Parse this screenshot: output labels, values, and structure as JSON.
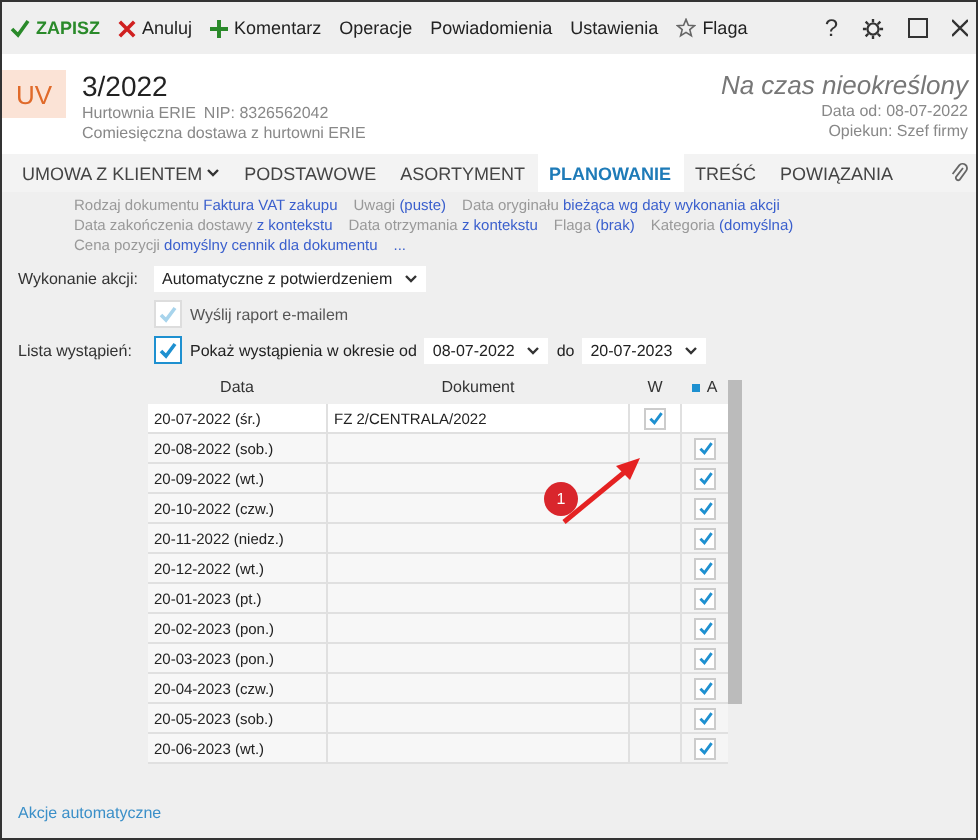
{
  "toolbar": {
    "items": [
      {
        "kind": "save",
        "label": "ZAPISZ"
      },
      {
        "kind": "cancel",
        "label": "Anuluj"
      },
      {
        "kind": "add",
        "label": "Komentarz"
      },
      {
        "kind": "plain",
        "label": "Operacje"
      },
      {
        "kind": "plain",
        "label": "Powiadomienia"
      },
      {
        "kind": "plain",
        "label": "Ustawienia"
      },
      {
        "kind": "star",
        "label": "Flaga"
      }
    ],
    "right": {
      "help": "?"
    }
  },
  "header": {
    "badge": "UV",
    "number": "3/2022",
    "company": "Hurtownia ERIE",
    "nip": "NIP: 8326562042",
    "description": "Comiesięczna dostawa z hurtowni ERIE",
    "status": "Na czas nieokreślony",
    "date": "Data od: 08-07-2022",
    "owner": "Opiekun: Szef firmy"
  },
  "tabs": [
    {
      "label": "UMOWA Z KLIENTEM",
      "selected": false,
      "dropdown": true
    },
    {
      "label": "PODSTAWOWE",
      "selected": false,
      "dropdown": false
    },
    {
      "label": "ASORTYMENT",
      "selected": false,
      "dropdown": false
    },
    {
      "label": "PLANOWANIE",
      "selected": true,
      "dropdown": false
    },
    {
      "label": "TREŚĆ",
      "selected": false,
      "dropdown": false
    },
    {
      "label": "POWIĄZANIA",
      "selected": false,
      "dropdown": false
    }
  ],
  "properties": [
    [
      {
        "label": "Rodzaj dokumentu",
        "value": "Faktura VAT zakupu"
      },
      {
        "label": "Uwagi",
        "value": "(puste)"
      },
      {
        "label": "Data oryginału",
        "value": "bieżąca wg daty wykonania akcji"
      }
    ],
    [
      {
        "label": "Data zakończenia dostawy",
        "value": "z kontekstu"
      },
      {
        "label": "Data otrzymania",
        "value": "z kontekstu"
      },
      {
        "label": "Flaga",
        "value": "(brak)"
      },
      {
        "label": "Kategoria",
        "value": "(domyślna)"
      }
    ],
    [
      {
        "label": "Cena pozycji",
        "value": "domyślny cennik dla dokumentu"
      },
      {
        "value": "..."
      }
    ]
  ],
  "execution": {
    "label": "Wykonanie akcji:",
    "value": "Automatyczne z potwierdzeniem"
  },
  "report": {
    "label": "Wyślij raport e-mailem",
    "checked": true,
    "disabled": true
  },
  "occurrences": {
    "label": "Lista wystąpień:",
    "checkbox_label": "Pokaż wystąpienia w okresie od",
    "checked": true,
    "from": "08-07-2022",
    "to_label": "do",
    "to": "20-07-2023"
  },
  "table": {
    "columns": [
      "Data",
      "Dokument",
      "W",
      "A"
    ],
    "rows": [
      {
        "date": "20-07-2022 (śr.)",
        "document": "FZ 2/CENTRALA/2022",
        "w_checked": true,
        "a_checked": false
      },
      {
        "date": "20-08-2022 (sob.)",
        "document": "",
        "w_checked": false,
        "a_checked": true
      },
      {
        "date": "20-09-2022 (wt.)",
        "document": "",
        "w_checked": false,
        "a_checked": true
      },
      {
        "date": "20-10-2022 (czw.)",
        "document": "",
        "w_checked": false,
        "a_checked": true
      },
      {
        "date": "20-11-2022 (niedz.)",
        "document": "",
        "w_checked": false,
        "a_checked": true
      },
      {
        "date": "20-12-2022 (wt.)",
        "document": "",
        "w_checked": false,
        "a_checked": true
      },
      {
        "date": "20-01-2023 (pt.)",
        "document": "",
        "w_checked": false,
        "a_checked": true
      },
      {
        "date": "20-02-2023 (pon.)",
        "document": "",
        "w_checked": false,
        "a_checked": true
      },
      {
        "date": "20-03-2023 (pon.)",
        "document": "",
        "w_checked": false,
        "a_checked": true
      },
      {
        "date": "20-04-2023 (czw.)",
        "document": "",
        "w_checked": false,
        "a_checked": true
      },
      {
        "date": "20-05-2023 (sob.)",
        "document": "",
        "w_checked": false,
        "a_checked": true
      },
      {
        "date": "20-06-2023 (wt.)",
        "document": "",
        "w_checked": false,
        "a_checked": true
      }
    ]
  },
  "annotation": {
    "number": "1"
  },
  "footer": {
    "link": "Akcje automatyczne"
  }
}
